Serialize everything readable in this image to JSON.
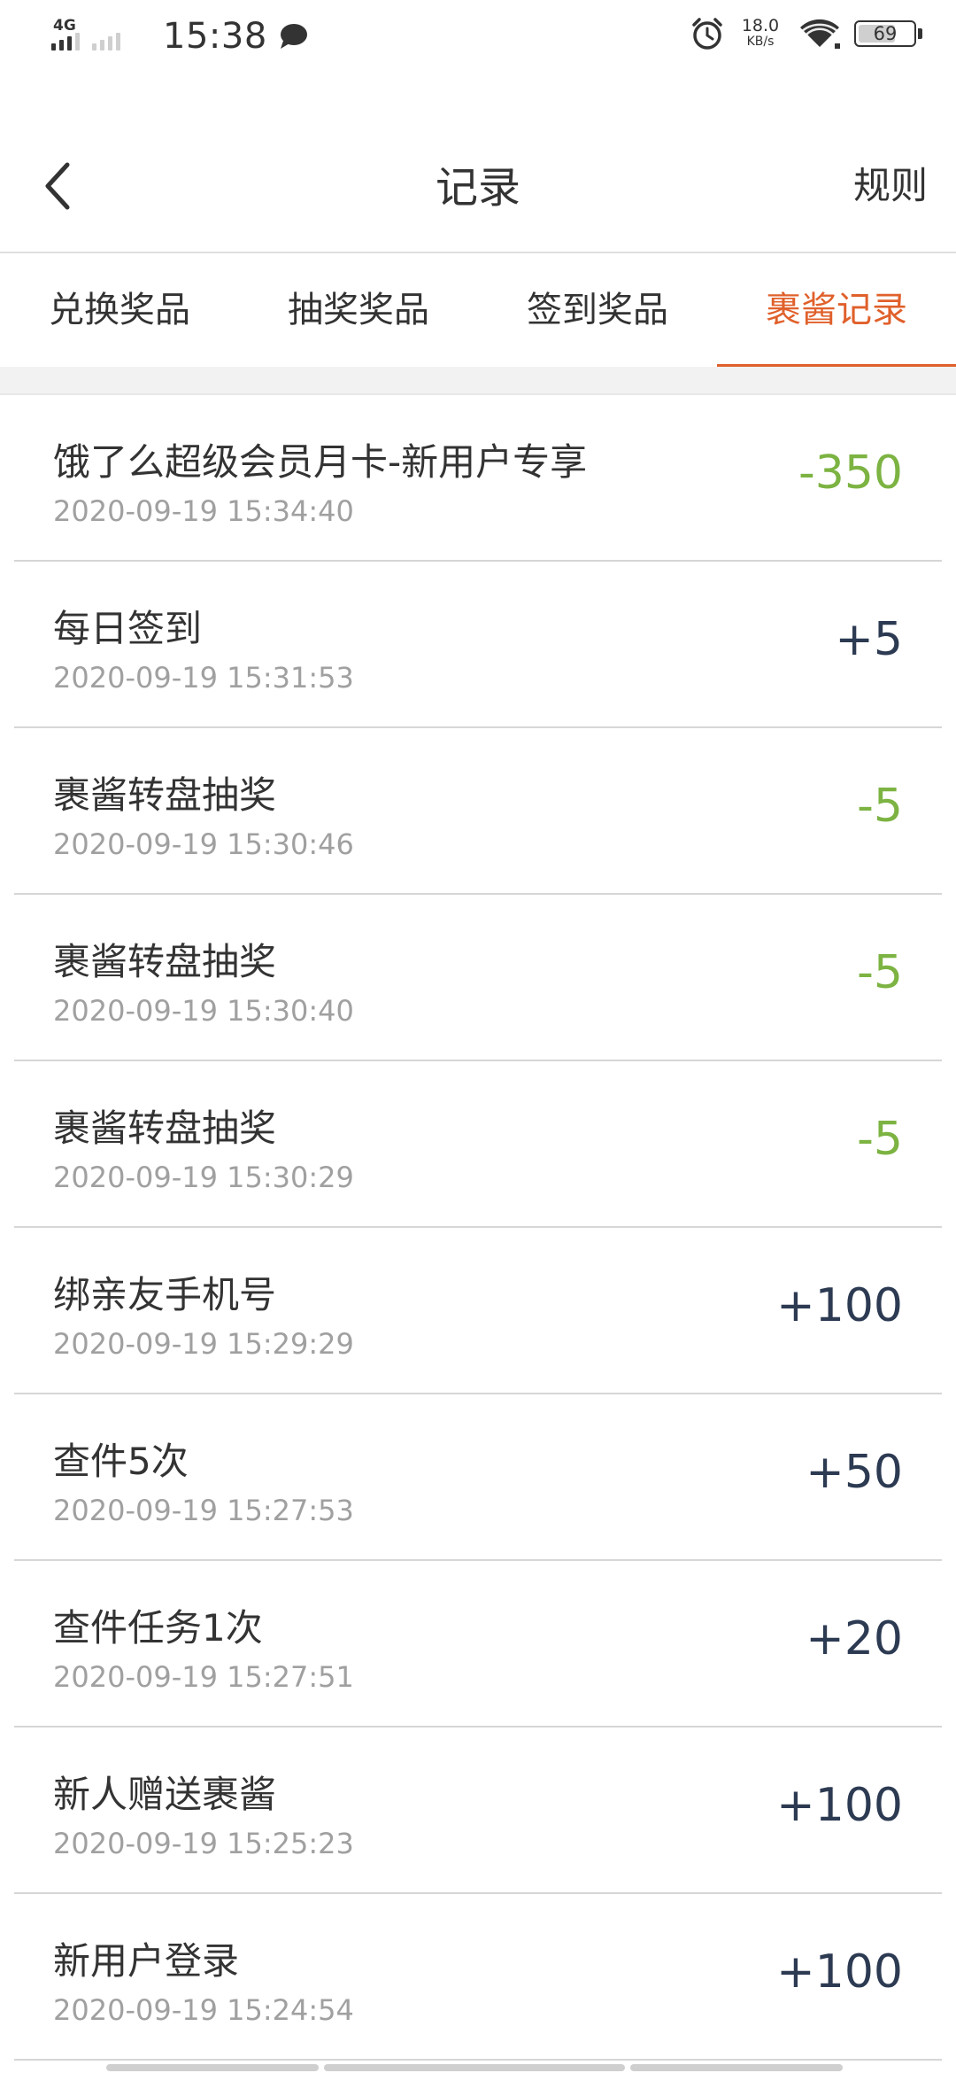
{
  "status_bar": {
    "network": "4G",
    "time": "15:38",
    "speed_value": "18.0",
    "speed_unit": "KB/s",
    "battery": "69",
    "battery_level": 0.69,
    "icons": [
      "signal-icon",
      "chat-bubble-icon",
      "alarm-icon",
      "wifi-icon",
      "battery-icon"
    ]
  },
  "header": {
    "title": "记录",
    "rules_label": "规则",
    "back_icon": "chevron-left-icon"
  },
  "tabs": [
    {
      "label": "兑换奖品",
      "active": false
    },
    {
      "label": "抽奖奖品",
      "active": false
    },
    {
      "label": "签到奖品",
      "active": false
    },
    {
      "label": "裹酱记录",
      "active": true
    }
  ],
  "colors": {
    "accent": "#e0602b",
    "negative": "#7cb342",
    "positive": "#2c3a52",
    "time": "#a0a0a0"
  },
  "records": [
    {
      "title": "饿了么超级会员月卡-新用户专享",
      "time": "2020-09-19 15:34:40",
      "amount": "-350",
      "type": "neg"
    },
    {
      "title": "每日签到",
      "time": "2020-09-19 15:31:53",
      "amount": "+5",
      "type": "pos"
    },
    {
      "title": "裹酱转盘抽奖",
      "time": "2020-09-19 15:30:46",
      "amount": "-5",
      "type": "neg"
    },
    {
      "title": "裹酱转盘抽奖",
      "time": "2020-09-19 15:30:40",
      "amount": "-5",
      "type": "neg"
    },
    {
      "title": "裹酱转盘抽奖",
      "time": "2020-09-19 15:30:29",
      "amount": "-5",
      "type": "neg"
    },
    {
      "title": "绑亲友手机号",
      "time": "2020-09-19 15:29:29",
      "amount": "+100",
      "type": "pos"
    },
    {
      "title": "查件5次",
      "time": "2020-09-19 15:27:53",
      "amount": "+50",
      "type": "pos"
    },
    {
      "title": "查件任务1次",
      "time": "2020-09-19 15:27:51",
      "amount": "+20",
      "type": "pos"
    },
    {
      "title": "新人赠送裹酱",
      "time": "2020-09-19 15:25:23",
      "amount": "+100",
      "type": "pos"
    },
    {
      "title": "新用户登录",
      "time": "2020-09-19 15:24:54",
      "amount": "+100",
      "type": "pos"
    }
  ]
}
